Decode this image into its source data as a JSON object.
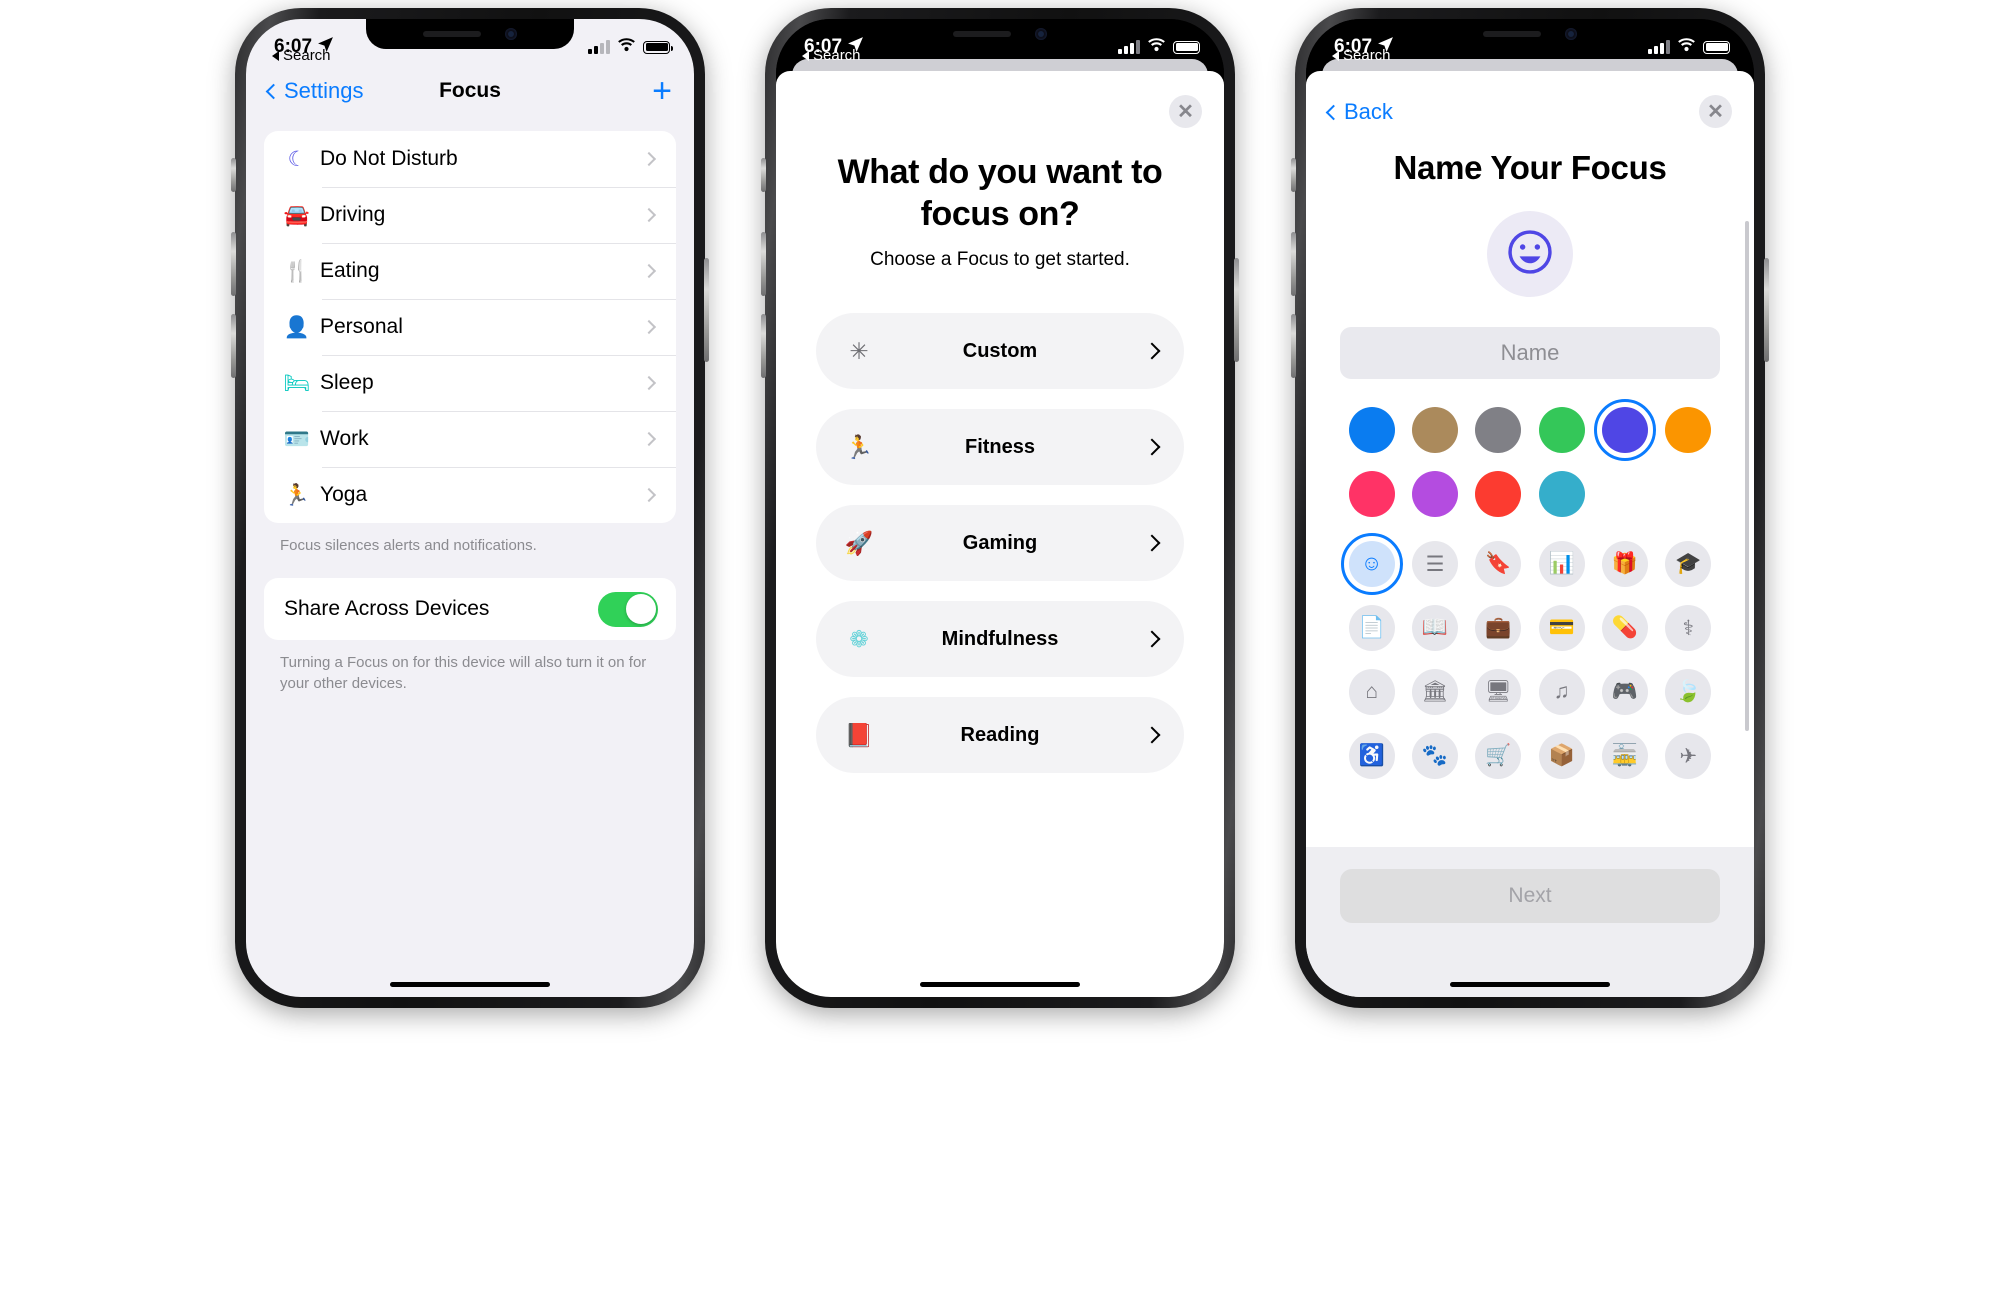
{
  "status_bar": {
    "time": "6:07",
    "location_icon": "location-arrow-icon",
    "back_label": "Search",
    "signal": "signal-bars-icon",
    "wifi": "wifi-icon",
    "battery": "battery-icon"
  },
  "phone1": {
    "nav": {
      "back_label": "Settings",
      "title": "Focus",
      "add_label": "+"
    },
    "focus_items": [
      {
        "label": "Do Not Disturb",
        "icon": "moon-icon",
        "glyph": "☾",
        "color": "#5e5ce6"
      },
      {
        "label": "Driving",
        "icon": "car-icon",
        "glyph": "🚘",
        "color": "#5e5ce6"
      },
      {
        "label": "Eating",
        "icon": "fork-knife-icon",
        "glyph": "🍴",
        "color": "#f5a623"
      },
      {
        "label": "Personal",
        "icon": "person-icon",
        "glyph": "👤",
        "color": "#bf5af2"
      },
      {
        "label": "Sleep",
        "icon": "bed-icon",
        "glyph": "🛏",
        "color": "#00c7be"
      },
      {
        "label": "Work",
        "icon": "id-badge-icon",
        "glyph": "🪪",
        "color": "#32ade6"
      },
      {
        "label": "Yoga",
        "icon": "running-person-icon",
        "glyph": "🏃",
        "color": "#30d158"
      }
    ],
    "list_footnote": "Focus silences alerts and notifications.",
    "share_toggle": {
      "label": "Share Across Devices",
      "state": "on",
      "on_color": "#30d158"
    },
    "share_footnote": "Turning a Focus on for this device will also turn it on for your other devices."
  },
  "phone2": {
    "close_label": "✕",
    "heading": "What do you want to focus on?",
    "subheading": "Choose a Focus to get started.",
    "options": [
      {
        "label": "Custom",
        "icon": "sparkle-wand-icon",
        "glyph": "✳",
        "color": "#6d6d72"
      },
      {
        "label": "Fitness",
        "icon": "running-person-icon",
        "glyph": "🏃",
        "color": "#30d158"
      },
      {
        "label": "Gaming",
        "icon": "rocket-icon",
        "glyph": "🚀",
        "color": "#0a84ff"
      },
      {
        "label": "Mindfulness",
        "icon": "flower-icon",
        "glyph": "❁",
        "color": "#64d2d8"
      },
      {
        "label": "Reading",
        "icon": "book-icon",
        "glyph": "📕",
        "color": "#ff9f0a"
      }
    ]
  },
  "phone3": {
    "back_label": "Back",
    "close_label": "✕",
    "heading": "Name Your Focus",
    "avatar_icon": "smiley-face-icon",
    "name_field": {
      "placeholder": "Name",
      "value": ""
    },
    "colors": [
      {
        "name": "blue",
        "hex": "#0a7cf0",
        "selected": false
      },
      {
        "name": "brown",
        "hex": "#ab8a5c",
        "selected": false
      },
      {
        "name": "gray",
        "hex": "#808086",
        "selected": false
      },
      {
        "name": "green",
        "hex": "#34c759",
        "selected": false
      },
      {
        "name": "indigo",
        "hex": "#4f46e5",
        "selected": true
      },
      {
        "name": "orange",
        "hex": "#fb9500",
        "selected": false
      },
      {
        "name": "pink",
        "hex": "#ff3366",
        "selected": false
      },
      {
        "name": "purple",
        "hex": "#b44ce0",
        "selected": false
      },
      {
        "name": "red",
        "hex": "#fc3b30",
        "selected": false
      },
      {
        "name": "teal",
        "hex": "#35aecb",
        "selected": false
      }
    ],
    "icons": [
      {
        "name": "smiley-face-icon",
        "glyph": "☺",
        "selected": true
      },
      {
        "name": "list-icon",
        "glyph": "☰",
        "selected": false
      },
      {
        "name": "bookmark-icon",
        "glyph": "🔖",
        "selected": false
      },
      {
        "name": "bar-chart-icon",
        "glyph": "📊",
        "selected": false
      },
      {
        "name": "gift-icon",
        "glyph": "🎁",
        "selected": false
      },
      {
        "name": "graduation-cap-icon",
        "glyph": "🎓",
        "selected": false
      },
      {
        "name": "document-icon",
        "glyph": "📄",
        "selected": false
      },
      {
        "name": "book-open-icon",
        "glyph": "📖",
        "selected": false
      },
      {
        "name": "briefcase-icon",
        "glyph": "💼",
        "selected": false
      },
      {
        "name": "credit-card-icon",
        "glyph": "💳",
        "selected": false
      },
      {
        "name": "pills-icon",
        "glyph": "💊",
        "selected": false
      },
      {
        "name": "stethoscope-icon",
        "glyph": "⚕",
        "selected": false
      },
      {
        "name": "house-icon",
        "glyph": "⌂",
        "selected": false
      },
      {
        "name": "bank-icon",
        "glyph": "🏛",
        "selected": false
      },
      {
        "name": "display-icon",
        "glyph": "🖥",
        "selected": false
      },
      {
        "name": "music-note-icon",
        "glyph": "♫",
        "selected": false
      },
      {
        "name": "gamepad-icon",
        "glyph": "🎮",
        "selected": false
      },
      {
        "name": "leaf-icon",
        "glyph": "🍃",
        "selected": false
      },
      {
        "name": "accessibility-icon",
        "glyph": "♿",
        "selected": false
      },
      {
        "name": "paw-print-icon",
        "glyph": "🐾",
        "selected": false
      },
      {
        "name": "cart-icon",
        "glyph": "🛒",
        "selected": false
      },
      {
        "name": "box-icon",
        "glyph": "📦",
        "selected": false
      },
      {
        "name": "tram-icon",
        "glyph": "🚋",
        "selected": false
      },
      {
        "name": "airplane-icon",
        "glyph": "✈",
        "selected": false
      }
    ],
    "next_button": {
      "label": "Next",
      "enabled": false
    }
  }
}
